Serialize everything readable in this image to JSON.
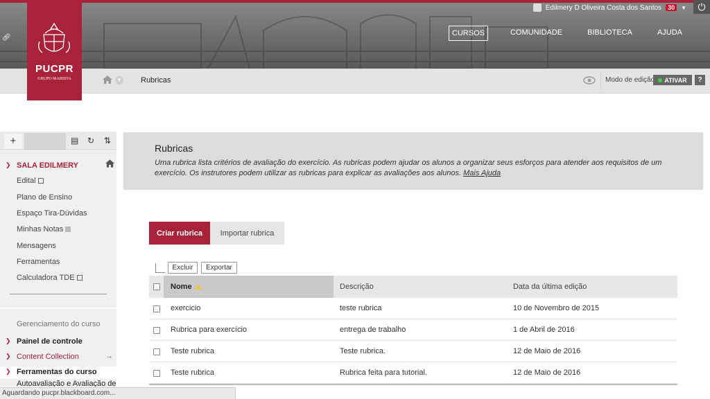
{
  "header": {
    "user_name": "Edilmery D Oliveira Costa dos Santos",
    "notification_count": "30",
    "nav": [
      {
        "label": "CURSOS",
        "active": true
      },
      {
        "label": "COMUNIDADE"
      },
      {
        "label": "BIBLIOTECA"
      },
      {
        "label": "AJUDA"
      }
    ],
    "logo": {
      "name": "PUCPR",
      "subtitle": "GRUPO MARISTA"
    }
  },
  "breadcrumb": {
    "title": "Rubricas"
  },
  "edit_mode": {
    "label": "Modo de edição",
    "toggle": "ATIVAR",
    "help": "?"
  },
  "sidebar": {
    "add_symbol": "+",
    "course_title": "SALA EDILMERY",
    "items": [
      {
        "label": "Edital",
        "icon": "external-link-icon"
      },
      {
        "label": "Plano de Ensino"
      },
      {
        "label": "Espaço Tira-Dúvidas"
      },
      {
        "label": "Minhas Notas",
        "icon": "grid-icon"
      },
      {
        "label": "Mensagens"
      },
      {
        "label": "Ferramentas"
      },
      {
        "label": "Calculadora TDE",
        "icon": "external-link-icon"
      }
    ],
    "management_title": "Gerenciamento do curso",
    "management": [
      {
        "label": "Painel de controle"
      },
      {
        "label": "Content Collection"
      },
      {
        "label": "Ferramentas do curso"
      }
    ],
    "management_sub": "Autoavaliação e Avaliação de"
  },
  "info": {
    "title": "Rubricas",
    "description": "Uma rubrica lista critérios de avaliação do exercício. As rubricas podem ajudar os alunos a organizar seus esforços para atender aos requisitos de um exercício. Os instrutores podem utilizar as rubricas para explicar as avaliações aos alunos.",
    "more_help": "Mais Ajuda"
  },
  "actions": {
    "create": "Criar rubrica",
    "import": "Importar rubrica",
    "delete": "Excluir",
    "export": "Exportar"
  },
  "table": {
    "headers": [
      "Nome",
      "Descrição",
      "Data da última edição"
    ],
    "rows": [
      {
        "name": "exercicio",
        "description": "teste rubrica",
        "date": "10 de Novembro de 2015"
      },
      {
        "name": "Rubrica para exercício",
        "description": "entrega de trabalho",
        "date": "1 de Abril de 2016"
      },
      {
        "name": "Teste rubrica",
        "description": "Teste rubrica.",
        "date": "12 de Maio de 2016"
      },
      {
        "name": "Teste rubrica",
        "description": "Rubrica feita para tutorial.",
        "date": "12 de Maio de 2016"
      }
    ]
  },
  "status_bar": "Aguardando pucpr.blackboard.com...",
  "colors": {
    "brand": "#a8233a",
    "active_dot": "#3fd13f"
  }
}
